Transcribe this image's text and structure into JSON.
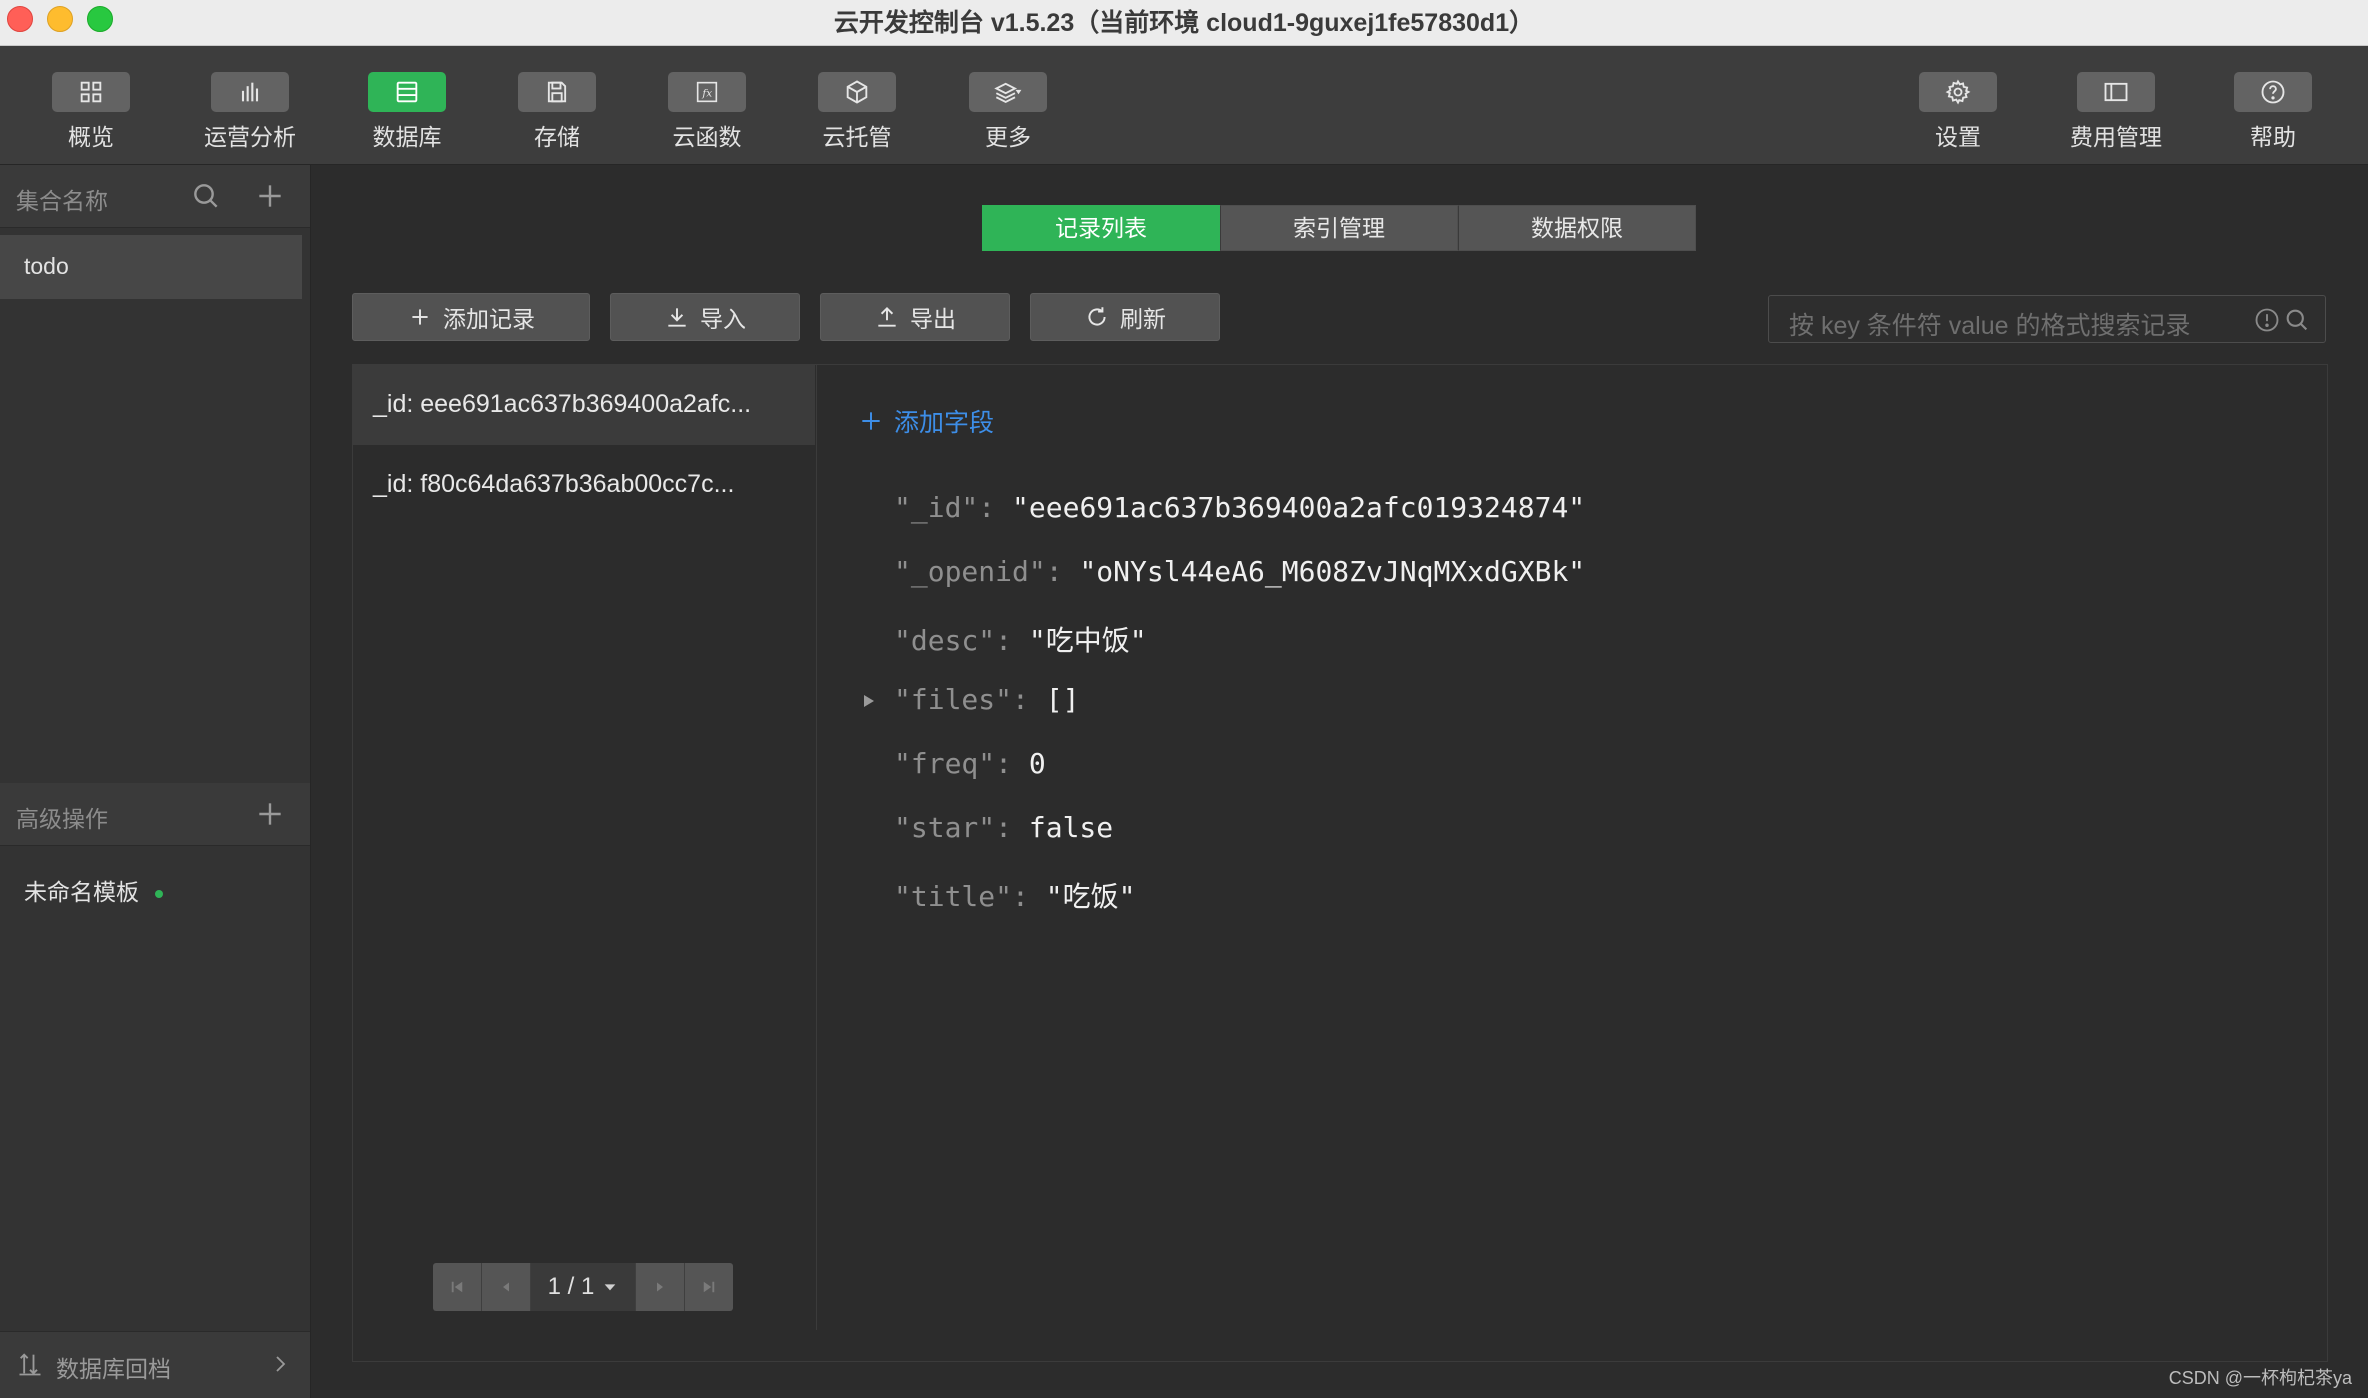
{
  "window": {
    "title": "云开发控制台 v1.5.23（当前环境 cloud1-9guxej1fe57830d1）"
  },
  "toolbar": {
    "left_items": [
      {
        "label": "概览",
        "icon": "grid-icon"
      },
      {
        "label": "运营分析",
        "icon": "bar-chart-icon"
      },
      {
        "label": "数据库",
        "icon": "database-icon",
        "active": true
      },
      {
        "label": "存储",
        "icon": "save-icon"
      },
      {
        "label": "云函数",
        "icon": "function-icon"
      },
      {
        "label": "云托管",
        "icon": "cube-icon"
      },
      {
        "label": "更多",
        "icon": "layers-icon"
      }
    ],
    "right_items": [
      {
        "label": "设置",
        "icon": "gear-icon"
      },
      {
        "label": "费用管理",
        "icon": "billing-icon"
      },
      {
        "label": "帮助",
        "icon": "help-icon"
      }
    ]
  },
  "sidebar": {
    "collections_header": "集合名称",
    "collections": [
      "todo"
    ],
    "advanced_header": "高级操作",
    "templates": [
      "未命名模板"
    ],
    "footer": "数据库回档"
  },
  "tabs": [
    "记录列表",
    "索引管理",
    "数据权限"
  ],
  "actions": {
    "add": "添加记录",
    "import": "导入",
    "export": "导出",
    "refresh": "刷新"
  },
  "search": {
    "placeholder": "按 key 条件符 value 的格式搜索记录"
  },
  "records": [
    "_id: eee691ac637b369400a2afc...",
    "_id: f80c64da637b36ab00cc7c..."
  ],
  "pagination": {
    "text": "1 / 1"
  },
  "detail": {
    "add_field": "添加字段",
    "fields": [
      {
        "key": "\"_id\": ",
        "value": "\"eee691ac637b369400a2afc019324874\""
      },
      {
        "key": "\"_openid\": ",
        "value": "\"oNYsl44eA6_M608ZvJNqMXxdGXBk\""
      },
      {
        "key": "\"desc\": ",
        "value": "\"吃中饭\""
      },
      {
        "key": "\"files\": ",
        "value": "[]"
      },
      {
        "key": "\"freq\": ",
        "value": "0"
      },
      {
        "key": "\"star\": ",
        "value": "false"
      },
      {
        "key": "\"title\": ",
        "value": "\"吃饭\""
      }
    ]
  },
  "watermark": "CSDN @一杯枸杞茶ya",
  "colors": {
    "accent": "#2fb457",
    "link": "#3d8ee8",
    "background": "#2c2c2c"
  }
}
